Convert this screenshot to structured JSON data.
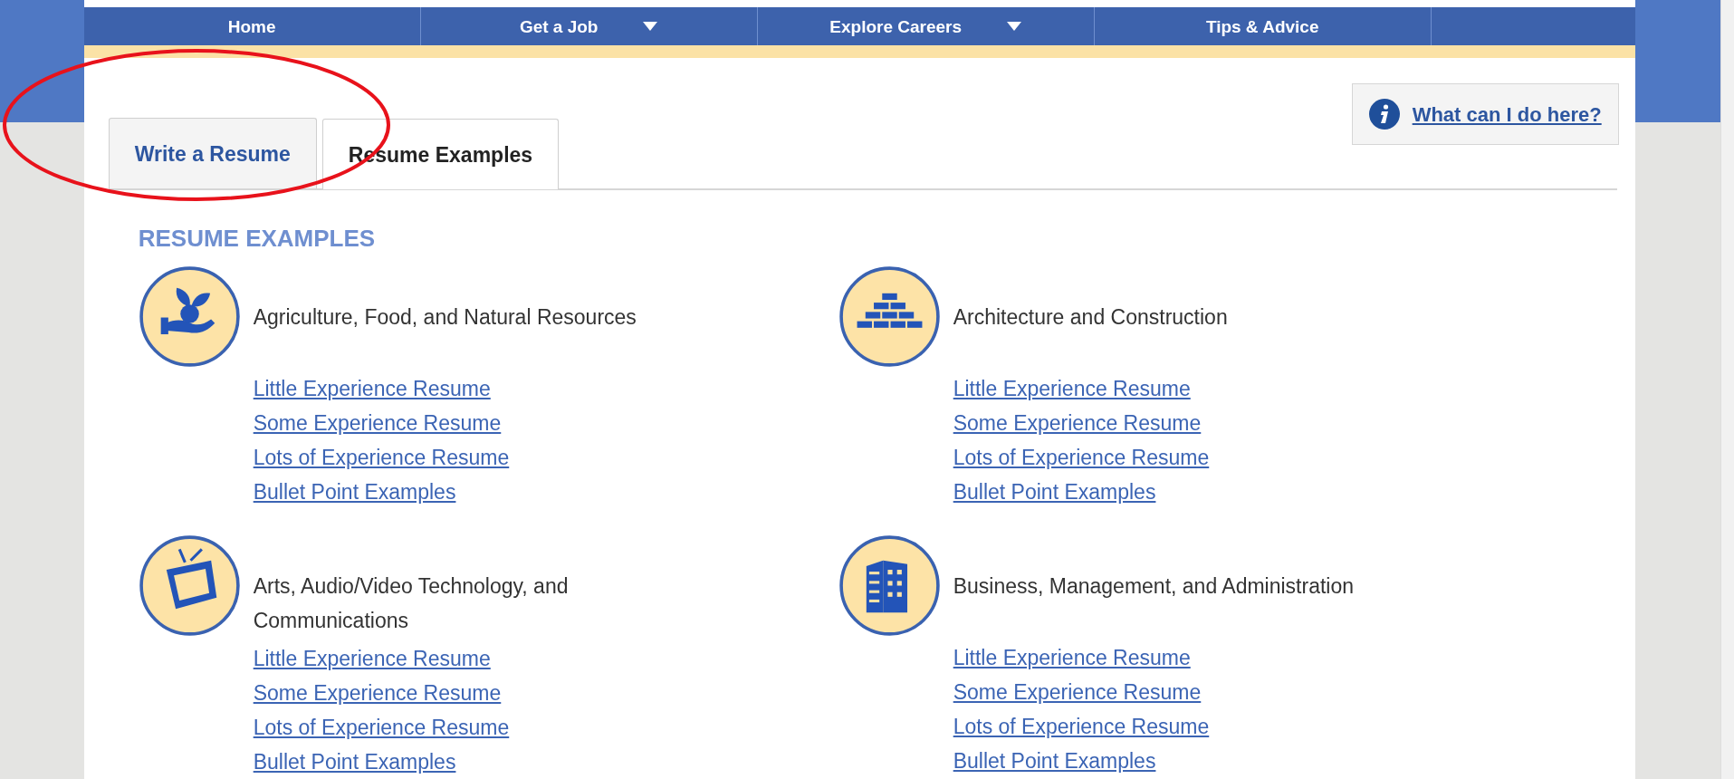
{
  "nav": [
    {
      "label": "Home",
      "has_menu": false
    },
    {
      "label": "Get a Job",
      "has_menu": true
    },
    {
      "label": "Explore Careers",
      "has_menu": true
    },
    {
      "label": "Tips & Advice",
      "has_menu": false
    }
  ],
  "tabs": [
    {
      "label": "Write a Resume",
      "selected": false
    },
    {
      "label": "Resume Examples",
      "selected": true
    }
  ],
  "help_link": "What can I do here?",
  "heading": "RESUME EXAMPLES",
  "categories": [
    {
      "title": "Agriculture, Food, and Natural Resources",
      "kind": "plant",
      "links": [
        "Little Experience Resume",
        "Some Experience Resume",
        "Lots of Experience Resume",
        "Bullet Point Examples"
      ]
    },
    {
      "title": "Architecture and Construction",
      "kind": "bricks",
      "links": [
        "Little Experience Resume",
        "Some Experience Resume",
        "Lots of Experience Resume",
        "Bullet Point Examples"
      ]
    },
    {
      "title": "Arts, Audio/Video Technology, and Communications",
      "kind": "tv",
      "links": [
        "Little Experience Resume",
        "Some Experience Resume",
        "Lots of Experience Resume",
        "Bullet Point Examples"
      ]
    },
    {
      "title": "Business, Management, and Administration",
      "kind": "building",
      "links": [
        "Little Experience Resume",
        "Some Experience Resume",
        "Lots of Experience Resume",
        "Bullet Point Examples"
      ]
    }
  ]
}
